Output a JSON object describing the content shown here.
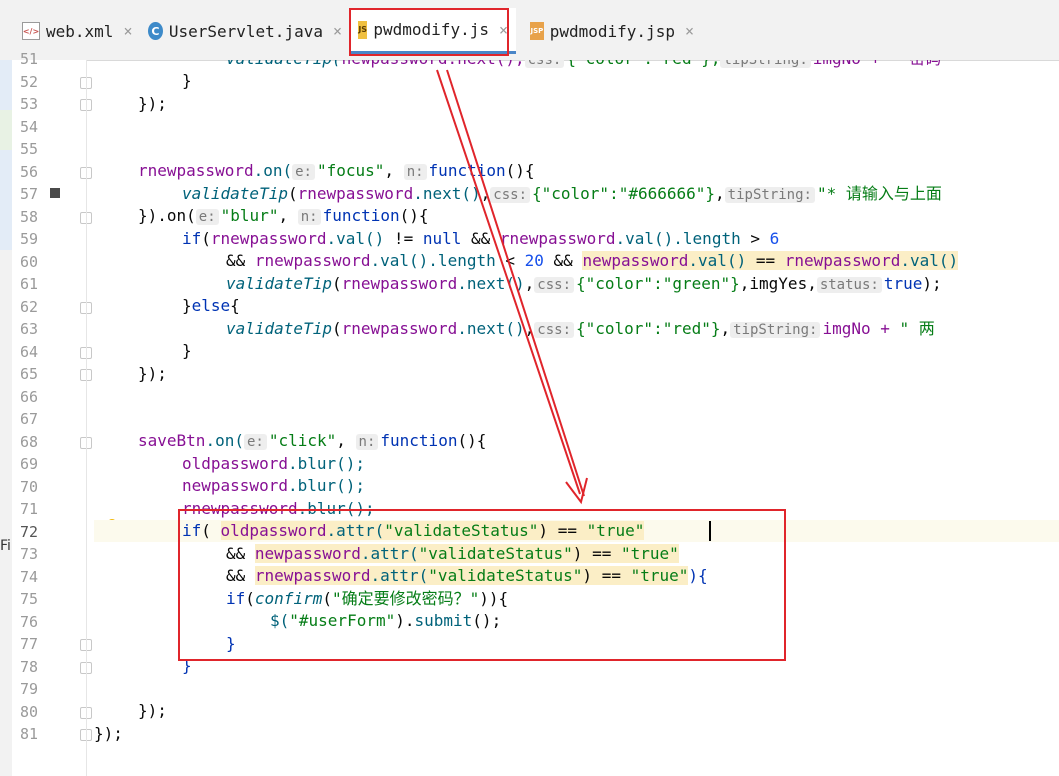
{
  "tabs": [
    {
      "label": "web.xml",
      "icon": "xml-file-icon",
      "icon_text": "</>",
      "active": false
    },
    {
      "label": "UserServlet.java",
      "icon": "java-class-icon",
      "icon_text": "C",
      "active": false
    },
    {
      "label": "pwdmodify.js",
      "icon": "js-file-icon",
      "icon_text": "JS",
      "active": true
    },
    {
      "label": "pwdmodify.jsp",
      "icon": "jsp-file-icon",
      "icon_text": "JSP",
      "active": false
    }
  ],
  "tab_close_glyph": "×",
  "line_numbers": [
    "51",
    "52",
    "53",
    "54",
    "55",
    "56",
    "57",
    "58",
    "59",
    "60",
    "61",
    "62",
    "63",
    "64",
    "65",
    "66",
    "67",
    "68",
    "69",
    "70",
    "71",
    "72",
    "73",
    "74",
    "75",
    "76",
    "77",
    "78",
    "79",
    "80",
    "81"
  ],
  "current_line": "72",
  "overflow_text": "Fi",
  "code": {
    "l51": {
      "a": "validateTip(",
      "b": "newpassword.next(),",
      "h1": "css:",
      "c": "{\"color\":\"red\"},",
      "h2": "tipString:",
      "d": "imgNo + \" 密码"
    },
    "l52": "}",
    "l53": "});",
    "l56": {
      "obj": "rnewpassword",
      "on": ".on(",
      "h1": "e:",
      "s1": "\"focus\"",
      "h2": "n:",
      "fn": "function",
      "tail": "(){"
    },
    "l57": {
      "call": "validateTip",
      "open": "(",
      "obj": "rnewpassword",
      "m": ".next()",
      "comma": ",",
      "h1": "css:",
      "s1": "{\"color\":\"#666666\"}",
      "h2": "tipString:",
      "s2": "\"* 请输入与上面"
    },
    "l58": {
      "a": "}).on(",
      "h1": "e:",
      "s1": "\"blur\"",
      "h2": "n:",
      "fn": "function",
      "tail": "(){"
    },
    "l59": {
      "kw": "if",
      "a": "(",
      "obj1": "rnewpassword",
      "m1": ".val()",
      "op1": " != ",
      "nul": "null",
      "op2": " && ",
      "obj2": "rnewpassword",
      "m2": ".val().length",
      "op3": " > ",
      "num": "6"
    },
    "l60": {
      "op": "&& ",
      "obj1": "rnewpassword",
      "m1": ".val().length",
      "op2": " < ",
      "num": "20",
      "op3": " && ",
      "obj2": "newpassword",
      "m2": ".val()",
      "op4": " == ",
      "obj3": "rnewpassword",
      "m3": ".val()"
    },
    "l61": {
      "call": "validateTip",
      "open": "(",
      "obj": "rnewpassword",
      "m": ".next()",
      "comma": ",",
      "h1": "css:",
      "s1": "{\"color\":\"green\"}",
      "mid": ",imgYes,",
      "h2": "status:",
      "kw": "true",
      "tail": ");"
    },
    "l62": {
      "a": "}",
      "kw": "else",
      "b": "{"
    },
    "l63": {
      "call": "validateTip",
      "open": "(",
      "obj": "rnewpassword",
      "m": ".next()",
      "comma": ",",
      "h1": "css:",
      "s1": "{\"color\":\"red\"}",
      "comma2": ",",
      "h2": "tipString:",
      "d": "imgNo + ",
      "s2": "\" 两"
    },
    "l64": "}",
    "l65": "});",
    "l68": {
      "obj": "saveBtn",
      "on": ".on(",
      "h1": "e:",
      "s1": "\"click\"",
      "h2": "n:",
      "fn": "function",
      "tail": "(){"
    },
    "l69": {
      "obj": "oldpassword",
      "m": ".blur();"
    },
    "l70": {
      "obj": "newpassword",
      "m": ".blur();"
    },
    "l71": {
      "obj": "rnewpassword",
      "m": ".blur();"
    },
    "l72": {
      "kw": "if",
      "a": "( ",
      "obj": "oldpassword",
      "m": ".attr(",
      "s1": "\"validateStatus\"",
      "b": ") == ",
      "s2": "\"true\""
    },
    "l73": {
      "op": "&& ",
      "obj": "newpassword",
      "m": ".attr(",
      "s1": "\"validateStatus\"",
      "b": ") == ",
      "s2": "\"true\""
    },
    "l74": {
      "op": "&& ",
      "obj": "rnewpassword",
      "m": ".attr(",
      "s1": "\"validateStatus\"",
      "b": ") == ",
      "s2": "\"true\"",
      "tail": "){"
    },
    "l75": {
      "kw": "if",
      "a": "(",
      "call": "confirm",
      "b": "(",
      "s1": "\"确定要修改密码？\"",
      "tail": ")){"
    },
    "l76": {
      "a": "$(",
      "s1": "\"#userForm\"",
      "b": ").",
      "fn": "submit",
      "tail": "();"
    },
    "l77": "}",
    "l78": "}",
    "l80": "});",
    "l81": "});"
  },
  "colors": {
    "annotation_red": "#e0252b",
    "keyword": "#0033b3",
    "string": "#067d17",
    "identifier": "#871094"
  }
}
